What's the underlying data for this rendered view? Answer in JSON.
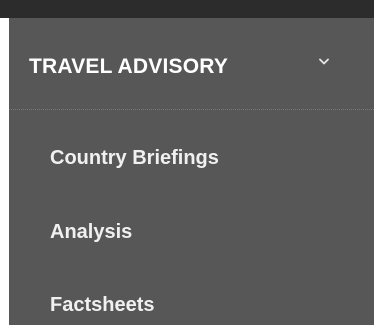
{
  "menu": {
    "section_title": "TRAVEL ADVISORY",
    "expand_icon": "chevron-down-icon",
    "items": [
      {
        "label": "Country Briefings"
      },
      {
        "label": "Analysis"
      },
      {
        "label": "Factsheets"
      }
    ]
  },
  "colors": {
    "top_bar": "#2c2c2c",
    "menu_background": "#575757",
    "text": "#ffffff"
  }
}
